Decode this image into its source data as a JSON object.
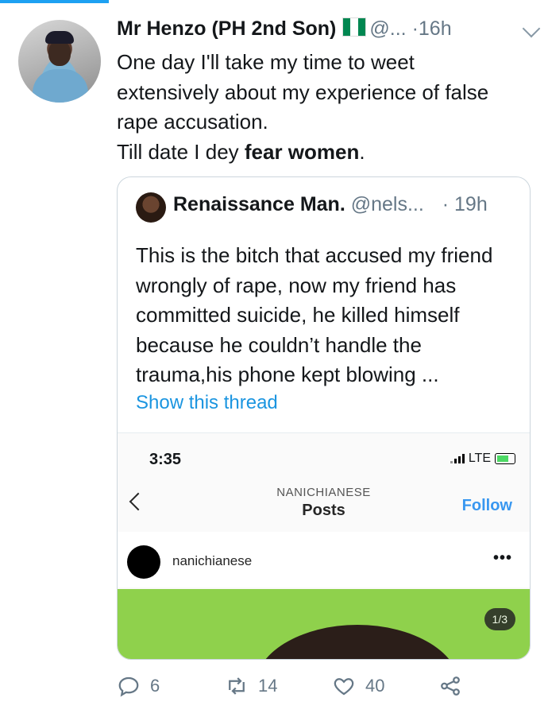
{
  "tweet": {
    "author_name": "Mr Henzo (PH 2nd Son)",
    "handle": "@...",
    "separator": "·",
    "time": "16h",
    "text_lines": [
      "One day I'll take my time to weet",
      "extensively about my experience of false",
      "rape accusation.",
      "Till date I dey "
    ],
    "text_bold": "fear women",
    "text_end": ".",
    "replies": "6",
    "retweets": "14",
    "likes": "40"
  },
  "quoted": {
    "author_name": "Renaissance Man.",
    "handle": "@nels...",
    "separator": "·",
    "time": "19h",
    "text": "This is the bitch that accused my friend wrongly of rape, now my friend has committed suicide, he killed himself because he couldn’t handle the trauma,his phone kept blowing ...",
    "show_thread": "Show this thread"
  },
  "instagram": {
    "status_time": "3:35",
    "network": "LTE",
    "account_caps": "NANICHIANESE",
    "page_title": "Posts",
    "follow_label": "Follow",
    "username": "nanichianese",
    "more": "•••",
    "photo_counter": "1/3"
  },
  "colors": {
    "accent": "#1da1f2",
    "link": "#1b95e0",
    "muted": "#657786",
    "instagram_follow": "#3897f0",
    "photo_background": "#8fd14c"
  },
  "icons": [
    "chevron-down-icon",
    "reply-icon",
    "retweet-icon",
    "like-icon",
    "share-icon",
    "back-arrow-icon",
    "signal-icon",
    "battery-icon"
  ]
}
